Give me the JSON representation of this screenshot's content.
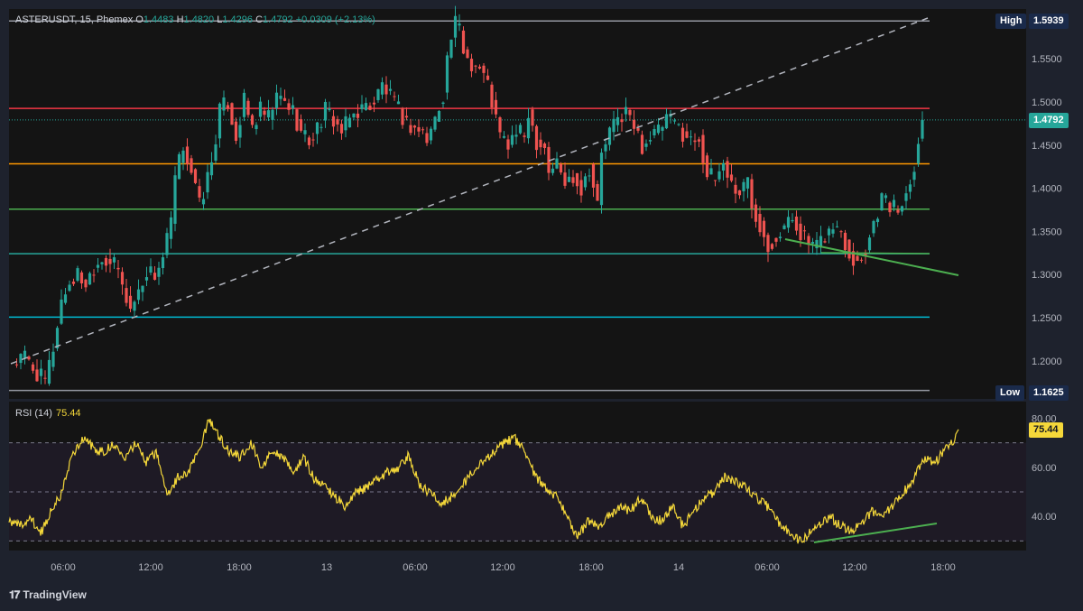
{
  "legend": {
    "symbol": "ASTERUSDT, 15, Phemex",
    "o_label": "O",
    "o": "1.4483",
    "h_label": "H",
    "h": "1.4820",
    "l_label": "L",
    "l": "1.4296",
    "c_label": "C",
    "c": "1.4792",
    "change": "+0.0309 (+2.13%)"
  },
  "labels": {
    "high_tag": "High",
    "high_value": "1.5939",
    "low_tag": "Low",
    "low_value": "1.1625",
    "last_price": "1.4792",
    "rsi_label": "RSI (14)",
    "rsi_value": "75.44",
    "brand": "TradingView"
  },
  "colors": {
    "background": "#1e222d",
    "up": "#26a69a",
    "down": "#ef5350",
    "rsi": "#f5d83a",
    "level_red": "#f23645",
    "level_orange": "#ff9800",
    "level_green": "#4caf50",
    "level_teal": "#26a69a",
    "level_cyan": "#00bcd4",
    "trend_line": "#4caf50"
  },
  "chart_data": [
    {
      "type": "candlestick",
      "price_ticks": [
        "1.5500",
        "1.5000",
        "1.4500",
        "1.4000",
        "1.3500",
        "1.3000",
        "1.2500",
        "1.2000"
      ],
      "ylim": [
        1.1625,
        1.5939
      ],
      "time_ticks": [
        "06:00",
        "12:00",
        "18:00",
        "13",
        "06:00",
        "12:00",
        "18:00",
        "14",
        "06:00",
        "12:00",
        "18:00"
      ],
      "levels": [
        1.4925,
        1.4283,
        1.3758,
        1.3242,
        1.2507
      ],
      "anchors": [
        [
          0,
          1.195
        ],
        [
          3,
          1.205
        ],
        [
          6,
          1.185
        ],
        [
          8,
          1.175
        ],
        [
          10,
          1.215
        ],
        [
          12,
          1.27
        ],
        [
          14,
          1.29
        ],
        [
          16,
          1.3
        ],
        [
          18,
          1.29
        ],
        [
          20,
          1.31
        ],
        [
          22,
          1.32
        ],
        [
          24,
          1.315
        ],
        [
          26,
          1.305
        ],
        [
          27,
          1.285
        ],
        [
          29,
          1.26
        ],
        [
          31,
          1.28
        ],
        [
          33,
          1.305
        ],
        [
          35,
          1.3
        ],
        [
          37,
          1.32
        ],
        [
          39,
          1.36
        ],
        [
          40,
          1.41
        ],
        [
          42,
          1.45
        ],
        [
          44,
          1.42
        ],
        [
          46,
          1.38
        ],
        [
          47,
          1.395
        ],
        [
          49,
          1.43
        ],
        [
          51,
          1.49
        ],
        [
          53,
          1.5
        ],
        [
          55,
          1.46
        ],
        [
          57,
          1.5
        ],
        [
          59,
          1.47
        ],
        [
          61,
          1.49
        ],
        [
          63,
          1.48
        ],
        [
          65,
          1.505
        ],
        [
          67,
          1.5
        ],
        [
          69,
          1.49
        ],
        [
          71,
          1.465
        ],
        [
          73,
          1.455
        ],
        [
          75,
          1.47
        ],
        [
          77,
          1.49
        ],
        [
          79,
          1.48
        ],
        [
          81,
          1.465
        ],
        [
          83,
          1.48
        ],
        [
          85,
          1.49
        ],
        [
          87,
          1.495
        ],
        [
          89,
          1.5
        ],
        [
          91,
          1.52
        ],
        [
          93,
          1.505
        ],
        [
          95,
          1.49
        ],
        [
          97,
          1.475
        ],
        [
          99,
          1.47
        ],
        [
          101,
          1.465
        ],
        [
          102,
          1.455
        ],
        [
          104,
          1.48
        ],
        [
          106,
          1.51
        ],
        [
          107,
          1.55
        ],
        [
          108,
          1.575
        ],
        [
          109,
          1.59
        ],
        [
          110,
          1.585
        ],
        [
          111,
          1.56
        ],
        [
          113,
          1.545
        ],
        [
          115,
          1.54
        ],
        [
          117,
          1.52
        ],
        [
          119,
          1.48
        ],
        [
          120,
          1.46
        ],
        [
          122,
          1.45
        ],
        [
          124,
          1.465
        ],
        [
          126,
          1.46
        ],
        [
          127,
          1.49
        ],
        [
          129,
          1.455
        ],
        [
          131,
          1.45
        ],
        [
          132,
          1.42
        ],
        [
          134,
          1.43
        ],
        [
          136,
          1.405
        ],
        [
          138,
          1.415
        ],
        [
          140,
          1.4
        ],
        [
          142,
          1.425
        ],
        [
          144,
          1.38
        ],
        [
          145,
          1.44
        ],
        [
          147,
          1.465
        ],
        [
          149,
          1.48
        ],
        [
          151,
          1.49
        ],
        [
          153,
          1.47
        ],
        [
          155,
          1.45
        ],
        [
          157,
          1.46
        ],
        [
          159,
          1.465
        ],
        [
          161,
          1.48
        ],
        [
          163,
          1.475
        ],
        [
          165,
          1.465
        ],
        [
          167,
          1.455
        ],
        [
          169,
          1.46
        ],
        [
          171,
          1.415
        ],
        [
          173,
          1.41
        ],
        [
          175,
          1.43
        ],
        [
          177,
          1.405
        ],
        [
          179,
          1.395
        ],
        [
          181,
          1.41
        ],
        [
          182,
          1.38
        ],
        [
          184,
          1.36
        ],
        [
          186,
          1.335
        ],
        [
          188,
          1.345
        ],
        [
          190,
          1.355
        ],
        [
          192,
          1.365
        ],
        [
          194,
          1.35
        ],
        [
          196,
          1.335
        ],
        [
          198,
          1.33
        ],
        [
          200,
          1.345
        ],
        [
          202,
          1.355
        ],
        [
          204,
          1.35
        ],
        [
          206,
          1.325
        ],
        [
          208,
          1.315
        ],
        [
          210,
          1.33
        ],
        [
          212,
          1.36
        ],
        [
          214,
          1.39
        ],
        [
          216,
          1.38
        ],
        [
          218,
          1.375
        ],
        [
          220,
          1.395
        ],
        [
          222,
          1.43
        ],
        [
          224,
          1.4792
        ]
      ]
    },
    {
      "type": "line",
      "name": "RSI (14)",
      "ylim": [
        26,
        84
      ],
      "y_ticks": [
        "80.00",
        "60.00",
        "40.00"
      ],
      "bands": [
        70,
        50,
        30
      ],
      "values": [
        38,
        36,
        40,
        33,
        42,
        50,
        65,
        72,
        68,
        66,
        70,
        64,
        70,
        62,
        66,
        48,
        56,
        58,
        66,
        80,
        72,
        66,
        64,
        70,
        60,
        66,
        64,
        58,
        64,
        55,
        52,
        48,
        44,
        50,
        52,
        55,
        58,
        60,
        65,
        52,
        50,
        45,
        48,
        52,
        58,
        62,
        66,
        70,
        72,
        66,
        56,
        52,
        48,
        40,
        32,
        38,
        36,
        40,
        44,
        42,
        48,
        40,
        38,
        44,
        36,
        42,
        48,
        50,
        56,
        54,
        52,
        48,
        44,
        38,
        34,
        30,
        33,
        36,
        40,
        36,
        34,
        38,
        42,
        40,
        45,
        50,
        56,
        64,
        62,
        68,
        72
      ]
    }
  ]
}
